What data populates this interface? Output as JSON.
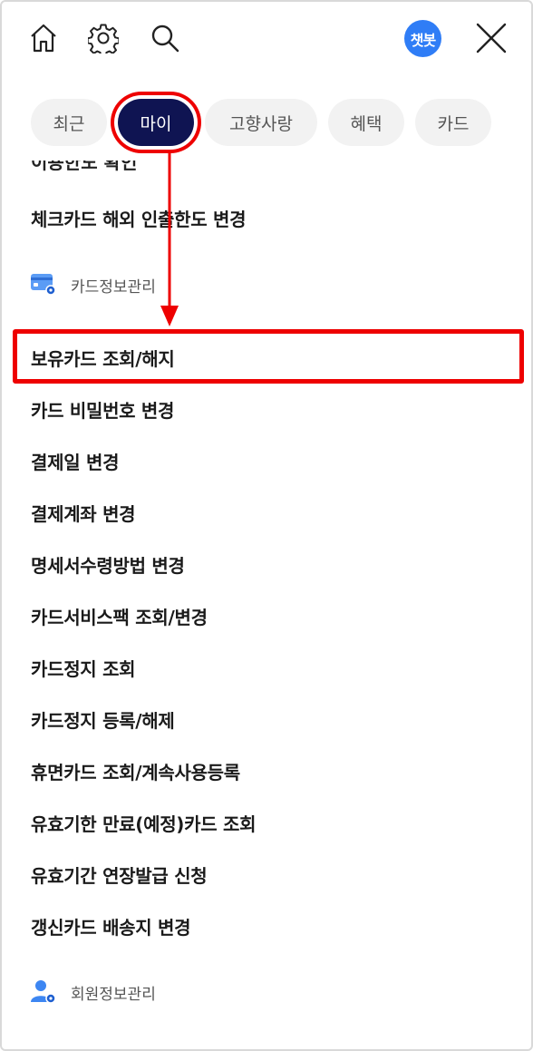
{
  "header": {
    "chatbot_label": "챗봇"
  },
  "tabs": [
    {
      "label": "최근"
    },
    {
      "label": "마이"
    },
    {
      "label": "고향사랑"
    },
    {
      "label": "혜택"
    },
    {
      "label": "카드"
    }
  ],
  "menu": {
    "partial_item": "이용한도 확인",
    "top_item": "체크카드 해외 인출한도 변경",
    "card_section": {
      "label": "카드정보관리",
      "items": [
        "보유카드 조회/해지",
        "카드 비밀번호 변경",
        "결제일 변경",
        "결제계좌 변경",
        "명세서수령방법 변경",
        "카드서비스팩 조회/변경",
        "카드정지 조회",
        "카드정지 등록/해제",
        "휴면카드 조회/계속사용등록",
        "유효기한 만료(예정)카드 조회",
        "유효기간 연장발급 신청",
        "갱신카드 배송지 변경"
      ]
    },
    "member_section": {
      "label": "회원정보관리"
    }
  },
  "colors": {
    "accent_blue": "#2f7df6",
    "active_tab": "#0f1452",
    "highlight_red": "#ee0000"
  }
}
